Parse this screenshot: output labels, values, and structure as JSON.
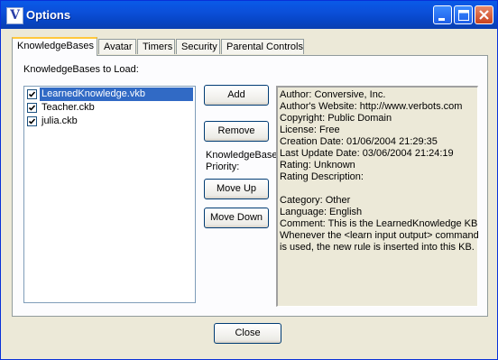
{
  "window": {
    "title": "Options",
    "app_icon": "V",
    "icons": [
      "minimize-icon",
      "maximize-icon",
      "close-icon"
    ]
  },
  "tabs": [
    "KnowledgeBases",
    "Avatar",
    "Timers",
    "Security",
    "Parental Controls"
  ],
  "kb": {
    "load_label": "KnowledgeBases to Load:",
    "items": [
      {
        "name": "LearnedKnowledge.vkb",
        "checked": true,
        "selected": true
      },
      {
        "name": "Teacher.ckb",
        "checked": true,
        "selected": false
      },
      {
        "name": "julia.ckb",
        "checked": true,
        "selected": false
      }
    ],
    "add_label": "Add",
    "remove_label": "Remove",
    "priority_label_1": "KnowledgeBase",
    "priority_label_2": "Priority:",
    "move_up_label": "Move Up",
    "move_down_label": "Move Down",
    "info_lines": [
      "Author: Conversive, Inc.",
      "Author's Website: http://www.verbots.com",
      "Copyright: Public Domain",
      "License: Free",
      "Creation Date: 01/06/2004 21:29:35",
      "Last Update Date: 03/06/2004 21:24:19",
      "Rating: Unknown",
      "Rating Description:",
      "",
      "Category: Other",
      "Language: English",
      "Comment: This is the LearnedKnowledge KB",
      "Whenever the <learn input output> command",
      "is used, the new rule is inserted into this KB."
    ]
  },
  "close_label": "Close"
}
